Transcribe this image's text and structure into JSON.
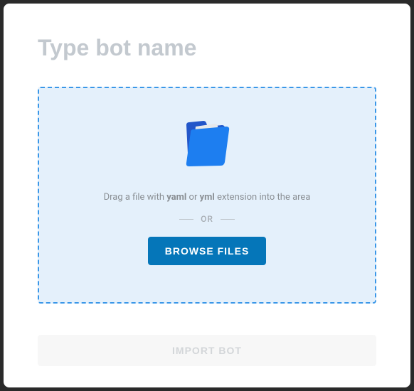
{
  "name_input": {
    "placeholder": "Type bot name",
    "value": ""
  },
  "dropzone": {
    "drag_prefix": "Drag a file with ",
    "ext1": "yaml",
    "or_word": " or ",
    "ext2": "yml",
    "drag_suffix": " extension into the area",
    "divider": "OR",
    "browse_label": "BROWSE FILES",
    "icon": "folder-icon"
  },
  "import_button": {
    "label": "IMPORT BOT",
    "enabled": false
  }
}
